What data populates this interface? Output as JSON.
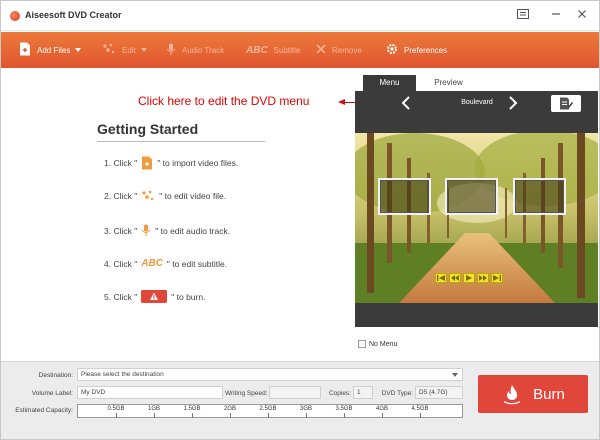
{
  "window": {
    "title": "Aiseesoft DVD Creator",
    "controls": [
      "feedback",
      "minimize",
      "close"
    ]
  },
  "toolbar": {
    "add_files": "Add Files",
    "edit": "Edit",
    "audio_track": "Audio Track",
    "subtitle": "Subtitle",
    "subtitle_icon_text": "ABC",
    "remove": "Remove",
    "preferences": "Preferences"
  },
  "callout": "Click here to edit the DVD menu",
  "getting_started": {
    "title": "Getting Started",
    "steps": [
      {
        "prefix": "1. Click \"",
        "suffix": "\" to import video files.",
        "icon": "import-file-icon"
      },
      {
        "prefix": "2. Click \"",
        "suffix": "\" to edit video file.",
        "icon": "edit-effects-icon"
      },
      {
        "prefix": "3. Click \"",
        "suffix": "\" to edit audio track.",
        "icon": "microphone-icon"
      },
      {
        "prefix": "4. Click \"",
        "suffix": "\" to edit subtitle.",
        "icon": "subtitle-abc-icon"
      },
      {
        "prefix": "5. Click \"",
        "suffix": "\" to burn.",
        "icon": "burn-flame-icon"
      }
    ],
    "abc_text": "ABC"
  },
  "preview": {
    "tabs": [
      {
        "label": "Menu",
        "active": true
      },
      {
        "label": "Preview",
        "active": false
      }
    ],
    "template_name": "Boulevard",
    "no_menu_label": "No Menu"
  },
  "bottom": {
    "destination_label": "Destination:",
    "destination_placeholder": "Please select the destination",
    "volume_label": "Volume Label:",
    "volume_value": "My DVD",
    "writing_speed_label": "Writing Speed:",
    "writing_speed_value": "",
    "copies_label": "Copies:",
    "copies_value": "1",
    "dvd_type_label": "DVD Type:",
    "dvd_type_value": "D5 (4.7G)",
    "estimated_capacity_label": "Estimated Capacity:",
    "capacity_ticks": [
      "0.5GB",
      "1GB",
      "1.5GB",
      "2GB",
      "2.5GB",
      "3GB",
      "3.5GB",
      "4GB",
      "4.5GB"
    ],
    "burn_label": "Burn"
  },
  "colors": {
    "accent": "#e85f33",
    "burn": "#e0473a",
    "callout": "#e60000",
    "dark_panel": "#3b3b3b"
  }
}
